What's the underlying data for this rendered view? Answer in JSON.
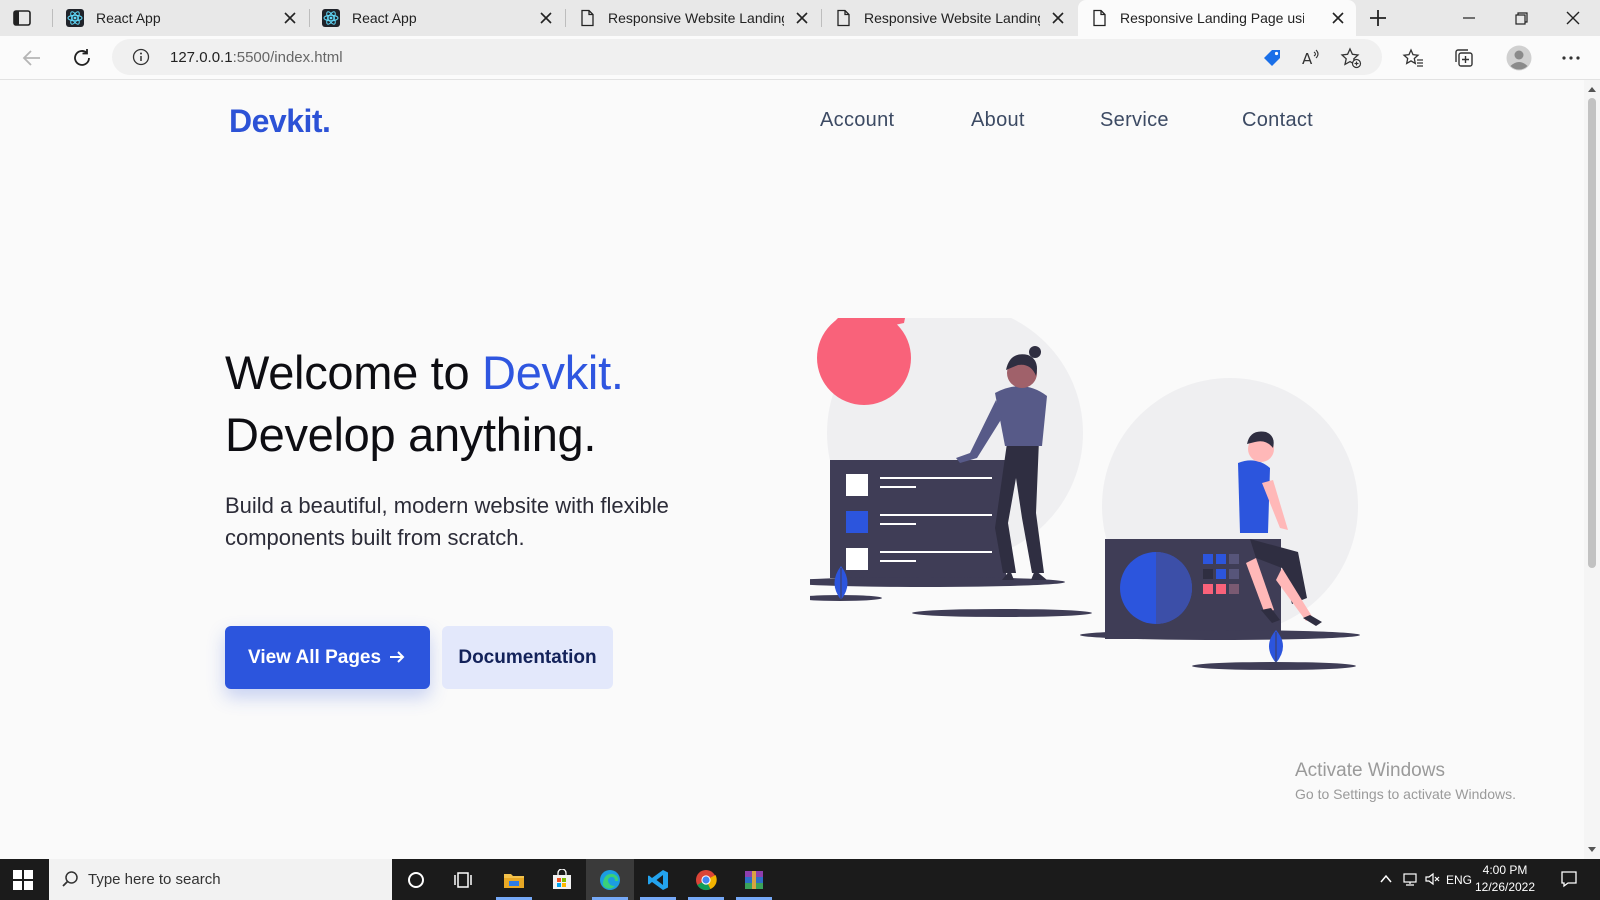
{
  "browser": {
    "tabs": [
      {
        "title": "React App",
        "icon": "react-icon",
        "active": false
      },
      {
        "title": "React App",
        "icon": "react-icon",
        "active": false
      },
      {
        "title": "Responsive Website Landing Pa",
        "icon": "page-icon",
        "active": false
      },
      {
        "title": "Responsive Website Landing Pa",
        "icon": "page-icon",
        "active": false
      },
      {
        "title": "Responsive Landing Page using",
        "icon": "page-icon",
        "active": true
      }
    ],
    "url_host": "127.0.0.1",
    "url_path": ":5500/index.html"
  },
  "page": {
    "logo": "Devkit.",
    "nav": [
      "Account",
      "About",
      "Service",
      "Contact"
    ],
    "hero": {
      "title_prefix": "Welcome to ",
      "title_accent": "Devkit.",
      "title_line2": "Develop anything.",
      "subtitle": "Build a beautiful, modern website with flexible components built from scratch.",
      "primary_button": "View All Pages",
      "secondary_button": "Documentation"
    },
    "colors": {
      "accent": "#2c55dd",
      "pink": "#f9627a",
      "dark": "#3f3d56"
    }
  },
  "watermark": {
    "line1": "Activate Windows",
    "line2": "Go to Settings to activate Windows."
  },
  "taskbar": {
    "search_placeholder": "Type here to search",
    "apps": [
      "cortana-icon",
      "task-view-icon",
      "file-explorer-icon",
      "store-icon",
      "edge-icon",
      "vscode-icon",
      "chrome-icon",
      "winrar-icon"
    ],
    "language": "ENG",
    "time": "4:00 PM",
    "date": "12/26/2022"
  }
}
